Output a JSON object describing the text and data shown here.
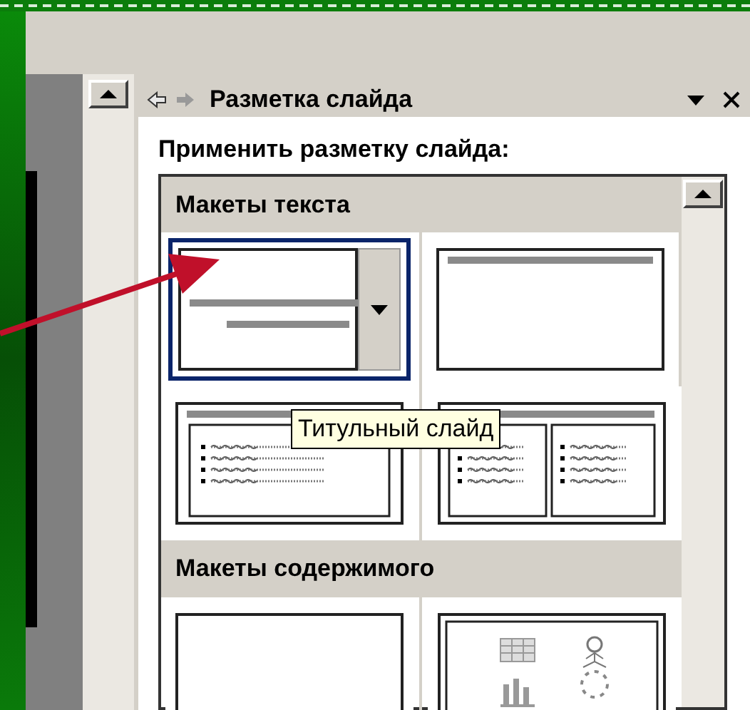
{
  "task_pane": {
    "title": "Разметка слайда",
    "subtitle": "Применить разметку слайда:",
    "sections": [
      {
        "title": "Макеты текста",
        "layouts": [
          {
            "kind": "title",
            "selected": true
          },
          {
            "kind": "title_only",
            "selected": false
          },
          {
            "kind": "title_text",
            "selected": false
          },
          {
            "kind": "two_columns",
            "selected": false
          }
        ]
      },
      {
        "title": "Макеты содержимого",
        "layouts": [
          {
            "kind": "blank",
            "selected": false
          },
          {
            "kind": "content",
            "selected": false
          }
        ]
      }
    ],
    "tooltip": "Титульный слайд"
  }
}
